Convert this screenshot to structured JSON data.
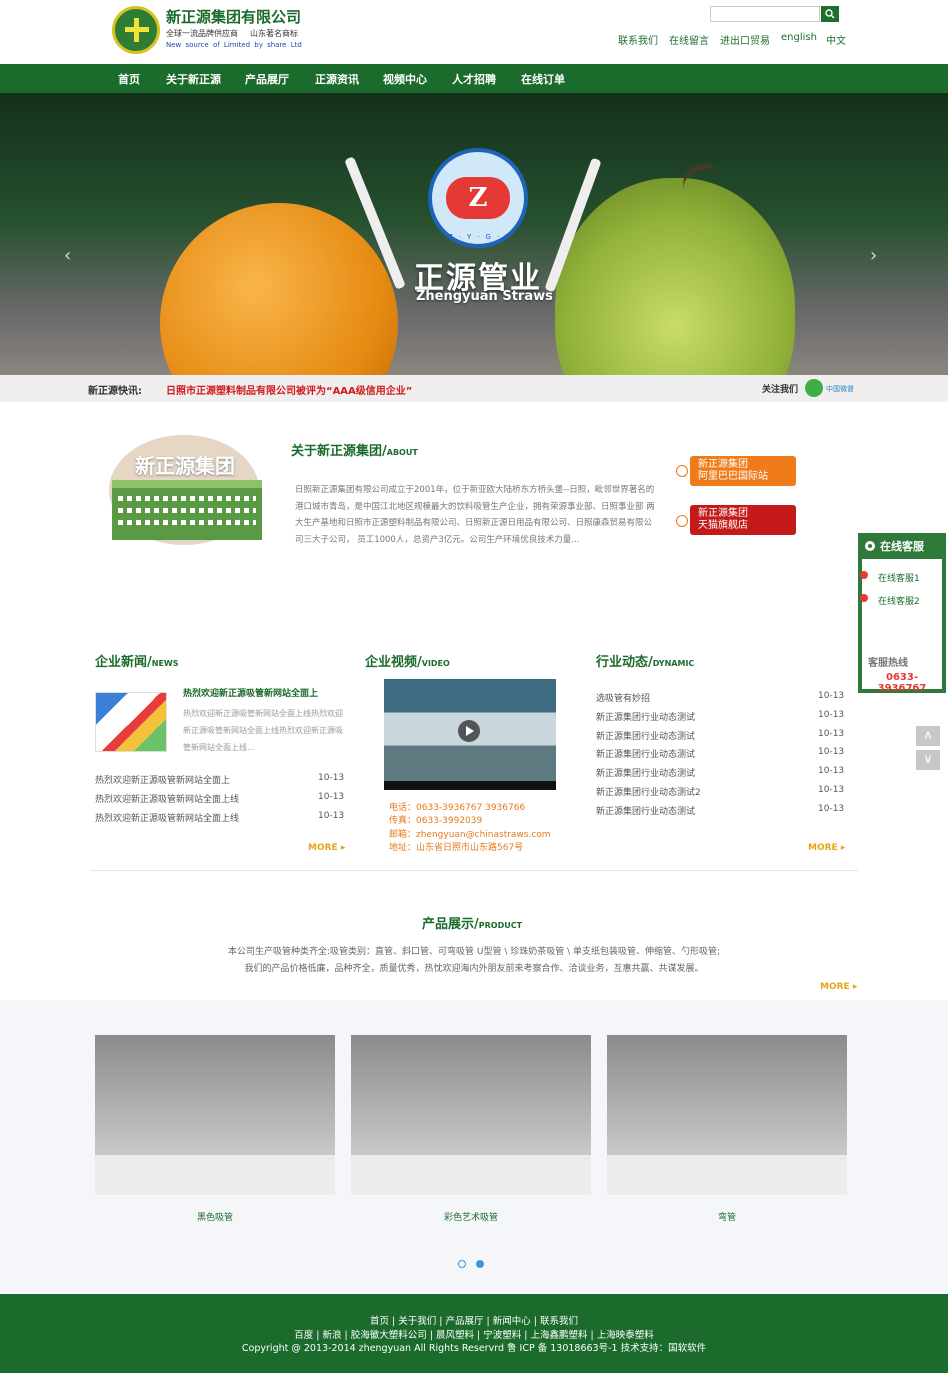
{
  "header": {
    "brand_name": "新正源集团有限公司",
    "brand_sub1": "全球一流品牌供应商",
    "brand_sub2": "山东著名商标",
    "brand_sub3": "New source of Limited by share Ltd",
    "search_placeholder": "",
    "links": [
      "联系我们",
      "在线留言",
      "进出口贸易",
      "english",
      "中文"
    ]
  },
  "nav": {
    "items": [
      "首页",
      "关于新正源",
      "产品展厅",
      "正源资讯",
      "视频中心",
      "人才招聘",
      "在线订单"
    ]
  },
  "banner": {
    "emblem_letter": "Z",
    "emblem_letters": "Z·Y·G·Y",
    "title": "正源管业",
    "subtitle": "Zhengyuan Straws",
    "prev": "‹",
    "next": "›"
  },
  "newsbar": {
    "label": "新正源快讯:",
    "text": "日照市正源塑料制品有限公司被评为“AAA级信用企业”",
    "follow": "关注我们",
    "wechat_label": "中国微督"
  },
  "about": {
    "image_text": "新正源集团",
    "title": "关于新正源集团/",
    "title_en": "ABOUT",
    "text": "日照新正源集团有限公司成立于2001年，位于新亚欧大陆桥东方桥头堡--日照，毗邻世界著名的港口城市青岛，是中国江北地区规模最大的饮料吸管生产企业，拥有荣源事业部、日照事业部 两大生产基地和日照市正源塑料制品有限公司、日照新正源日用品有限公司、日照康森贸易有限公司三大子公司， 员工1000人，总资产3亿元。公司生产环境优良技术力量...",
    "badge1": "新正源集团\n阿里巴巴国际站",
    "badge2": "新正源集团\n天猫旗舰店"
  },
  "news": {
    "title": "企业新闻/",
    "title_en": "NEWS",
    "feature_title": "热烈欢迎新正源吸管新网站全面上",
    "feature_body": "热烈欢迎新正源吸管新网站全面上线热烈欢迎新正源吸管新网站全面上线热烈欢迎新正源吸管新网站全面上线...",
    "items": [
      {
        "title": "热烈欢迎新正源吸管新网站全面上",
        "date": "10-13"
      },
      {
        "title": "热烈欢迎新正源吸管新网站全面上线",
        "date": "10-13"
      },
      {
        "title": "热烈欢迎新正源吸管新网站全面上线",
        "date": "10-13"
      }
    ],
    "more": "MORE ▸"
  },
  "video": {
    "title": "企业视频/",
    "title_en": "VIDEO",
    "contact": [
      "电话：0633-3936767 3936766",
      "传真：0633-3992039",
      "邮箱：zhengyuan@chinastraws.com",
      "地址：山东省日照市山东路567号"
    ]
  },
  "dynamic": {
    "title": "行业动态/",
    "title_en": "DYNAMIC",
    "items": [
      {
        "title": "选吸管有妙招",
        "date": "10-13"
      },
      {
        "title": "新正源集团行业动态测试",
        "date": "10-13"
      },
      {
        "title": "新正源集团行业动态测试",
        "date": "10-13"
      },
      {
        "title": "新正源集团行业动态测试",
        "date": "10-13"
      },
      {
        "title": "新正源集团行业动态测试",
        "date": "10-13"
      },
      {
        "title": "新正源集团行业动态测试2",
        "date": "10-13"
      },
      {
        "title": "新正源集团行业动态测试",
        "date": "10-13"
      }
    ],
    "more": "MORE ▸"
  },
  "products": {
    "title": "产品展示/",
    "title_en": "PRODUCT",
    "desc1": "本公司生产吸管种类齐全:吸管类别：直管、斜口管、可弯吸管 U型管 \\ 珍珠奶茶吸管 \\ 单支纸包装吸管、伸缩管、勺形吸管;",
    "desc2": "我们的产品价格低廉，品种齐全，质量优秀，热忱欢迎海内外朋友前来考察合作、洽谈业务，互惠共赢、共谋发展。",
    "more": "MORE ▸",
    "items": [
      {
        "name": "黑色吸管"
      },
      {
        "name": "彩色艺术吸管"
      },
      {
        "name": "弯管"
      }
    ]
  },
  "footer": {
    "line1": "首页 | 关于我们 | 产品展厅 | 新闻中心 | 联系我们",
    "line2": "百度 | 新浪 | 胶海徽大塑料公司 | 晨风塑料 | 宁波塑料 | 上海鑫鹏塑料 | 上海映泰塑料",
    "line3": "Copyright @ 2013-2014 zhengyuan All Rights Reservrd 鲁 ICP 备 13018663号-1 技术支持：国软软件"
  },
  "service": {
    "title": "在线客服",
    "item1": "在线客服1",
    "item2": "在线客服2",
    "hotline": "客服热线",
    "phone": "0633-3936767"
  }
}
